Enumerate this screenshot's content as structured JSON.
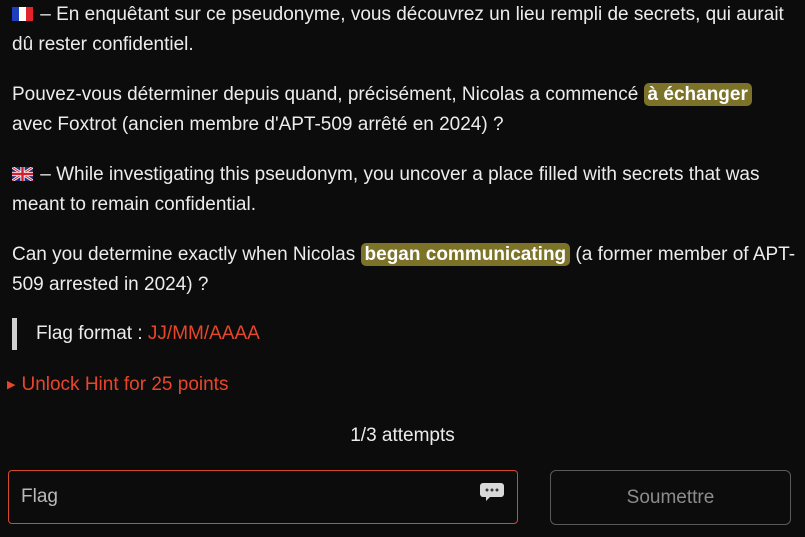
{
  "challenge": {
    "fr_intro_text": " – En enquêtant sur ce pseudonyme, vous découvrez un lieu rempli de secrets, qui aurait dû rester confidentiel.",
    "fr_question_before": "Pouvez-vous déterminer depuis quand, précisément, Nicolas a commencé ",
    "fr_question_highlight": "à échanger",
    "fr_question_after": " avec Foxtrot (ancien membre d'APT-509 arrêté en 2024) ?",
    "en_intro_text": " – While investigating this pseudonym, you uncover a place filled with secrets that was meant to remain confidential.",
    "en_question_before": "Can you determine exactly when Nicolas ",
    "en_question_highlight": "began communicating",
    "en_question_after": " (a former member of APT-509 arrested in 2024) ?",
    "flag_format_label": "Flag format : ",
    "flag_format_value": "JJ/MM/AAAA",
    "fr_flag_icon": "french-flag-emoji",
    "en_flag_icon": "uk-flag-emoji"
  },
  "hint": {
    "icon": "disclosure-triangle",
    "label": "Unlock Hint for 25 points"
  },
  "attempts": {
    "label": "1/3 attempts"
  },
  "form": {
    "flag_placeholder": "Flag",
    "flag_value": "",
    "password_icon": "password-manager-icon",
    "submit_label": "Soumettre"
  },
  "colors": {
    "background": "#0d0c0c",
    "highlight": "#7d7328",
    "accent": "#e8462a",
    "input_border": "#d34a2c"
  }
}
